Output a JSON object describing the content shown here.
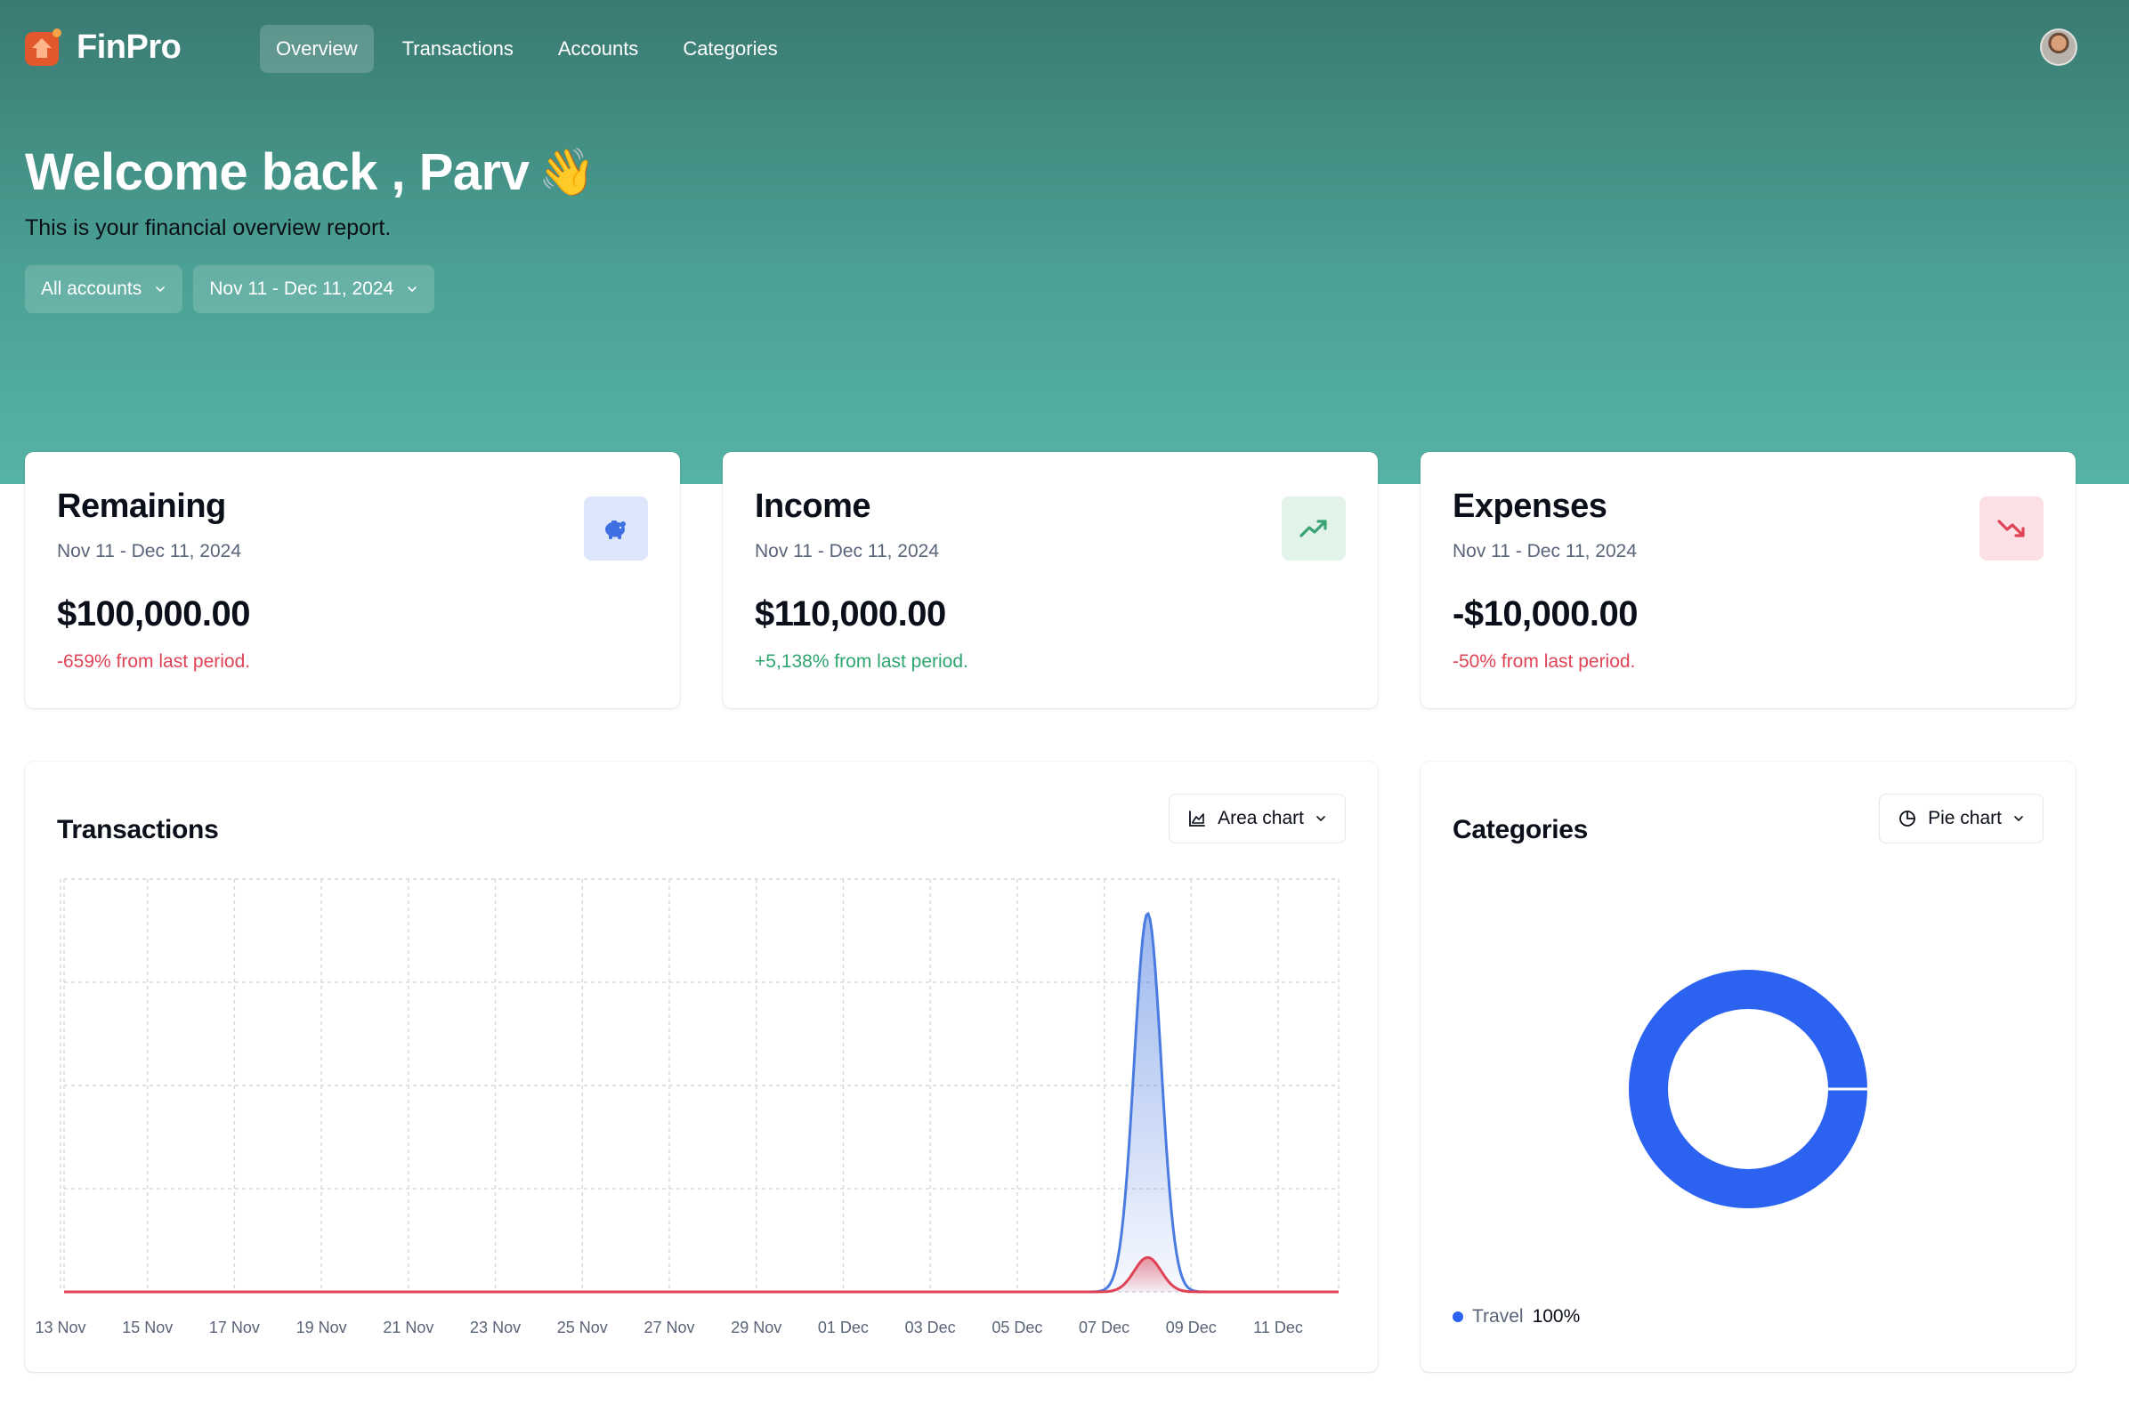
{
  "app": {
    "name": "FinPro"
  },
  "nav": {
    "items": [
      {
        "label": "Overview",
        "active": true
      },
      {
        "label": "Transactions",
        "active": false
      },
      {
        "label": "Accounts",
        "active": false
      },
      {
        "label": "Categories",
        "active": false
      }
    ]
  },
  "header": {
    "welcome": "Welcome back , Parv",
    "wave_emoji": "👋",
    "subtitle": "This is your financial overview report."
  },
  "filters": {
    "account": "All accounts",
    "date_range": "Nov 11 - Dec 11, 2024"
  },
  "stats": [
    {
      "title": "Remaining",
      "range": "Nov 11 - Dec 11, 2024",
      "value": "$100,000.00",
      "change": "-659% from last period.",
      "trend": "negative",
      "icon": "piggy-bank-icon",
      "icon_bg": "#dde6fb",
      "icon_color": "#3f6fe0"
    },
    {
      "title": "Income",
      "range": "Nov 11 - Dec 11, 2024",
      "value": "$110,000.00",
      "change": "+5,138% from last period.",
      "trend": "positive",
      "icon": "trending-up-icon",
      "icon_bg": "#e2f3ea",
      "icon_color": "#3aa373"
    },
    {
      "title": "Expenses",
      "range": "Nov 11 - Dec 11, 2024",
      "value": "-$10,000.00",
      "change": "-50% from last period.",
      "trend": "negative",
      "icon": "trending-down-icon",
      "icon_bg": "#fbe1e5",
      "icon_color": "#e04356"
    }
  ],
  "transactions_panel": {
    "title": "Transactions",
    "chart_type_label": "Area chart",
    "chart_icon": "area-chart-icon"
  },
  "categories_panel": {
    "title": "Categories",
    "chart_type_label": "Pie chart",
    "chart_icon": "pie-chart-icon",
    "legend": [
      {
        "label": "Travel",
        "value": "100%",
        "color": "#2b62f0"
      }
    ]
  },
  "colors": {
    "income": "#4a7be0",
    "expense": "#e04356",
    "accent": "#2b62f0"
  },
  "chart_data": [
    {
      "type": "area",
      "title": "Transactions",
      "tick_labels": [
        "13 Nov",
        "15 Nov",
        "17 Nov",
        "19 Nov",
        "21 Nov",
        "23 Nov",
        "25 Nov",
        "27 Nov",
        "29 Nov",
        "01 Dec",
        "03 Dec",
        "05 Dec",
        "07 Dec",
        "09 Dec",
        "11 Dec"
      ],
      "series": [
        {
          "name": "income",
          "peak_date": "08 Dec",
          "peak": 110000
        },
        {
          "name": "expenses",
          "peak_date": "08 Dec",
          "peak": 10000
        }
      ],
      "grid": true
    },
    {
      "type": "pie",
      "title": "Categories",
      "slices": [
        {
          "label": "Travel",
          "value": 100
        }
      ]
    }
  ]
}
